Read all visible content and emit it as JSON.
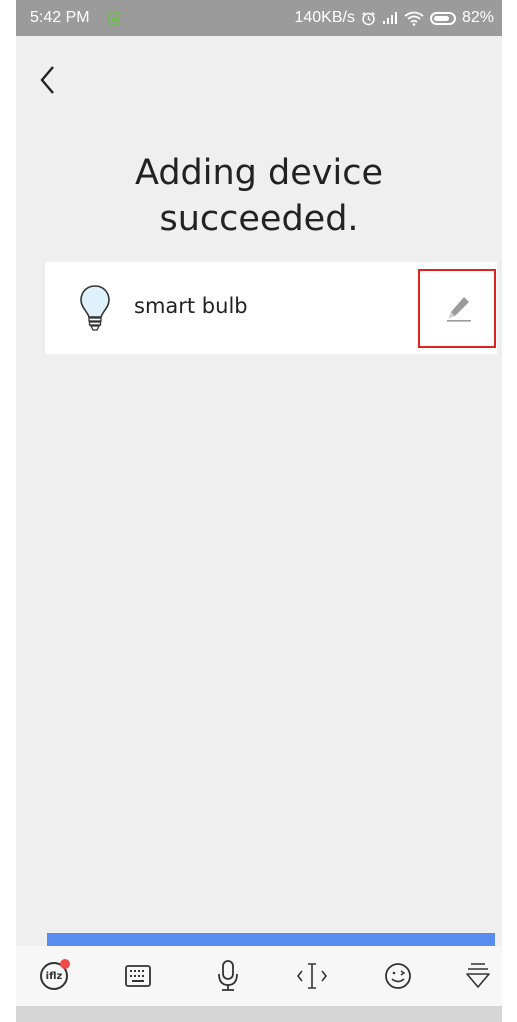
{
  "status_bar": {
    "time": "5:42 PM",
    "network_speed": "140KB/s",
    "battery_percent": "82%",
    "battery_level": 0.82,
    "icons": [
      "app-notification-icon",
      "alarm-icon",
      "signal-icon",
      "wifi-icon",
      "battery-icon"
    ]
  },
  "nav": {
    "back_icon": "chevron-left-icon"
  },
  "title": {
    "line1": "Adding device",
    "line2": "succeeded."
  },
  "device": {
    "name": "smart bulb",
    "icon": "light-bulb-icon",
    "edit_icon": "pencil-icon",
    "highlight_color": "#e0221f"
  },
  "keyboard_toolbar": {
    "ifly_label": "iflz",
    "items": [
      "ifly-logo-icon",
      "keyboard-icon",
      "microphone-icon",
      "text-cursor-icon",
      "emoji-icon",
      "collapse-keyboard-icon"
    ],
    "accent_color": "#5a8cf0"
  }
}
